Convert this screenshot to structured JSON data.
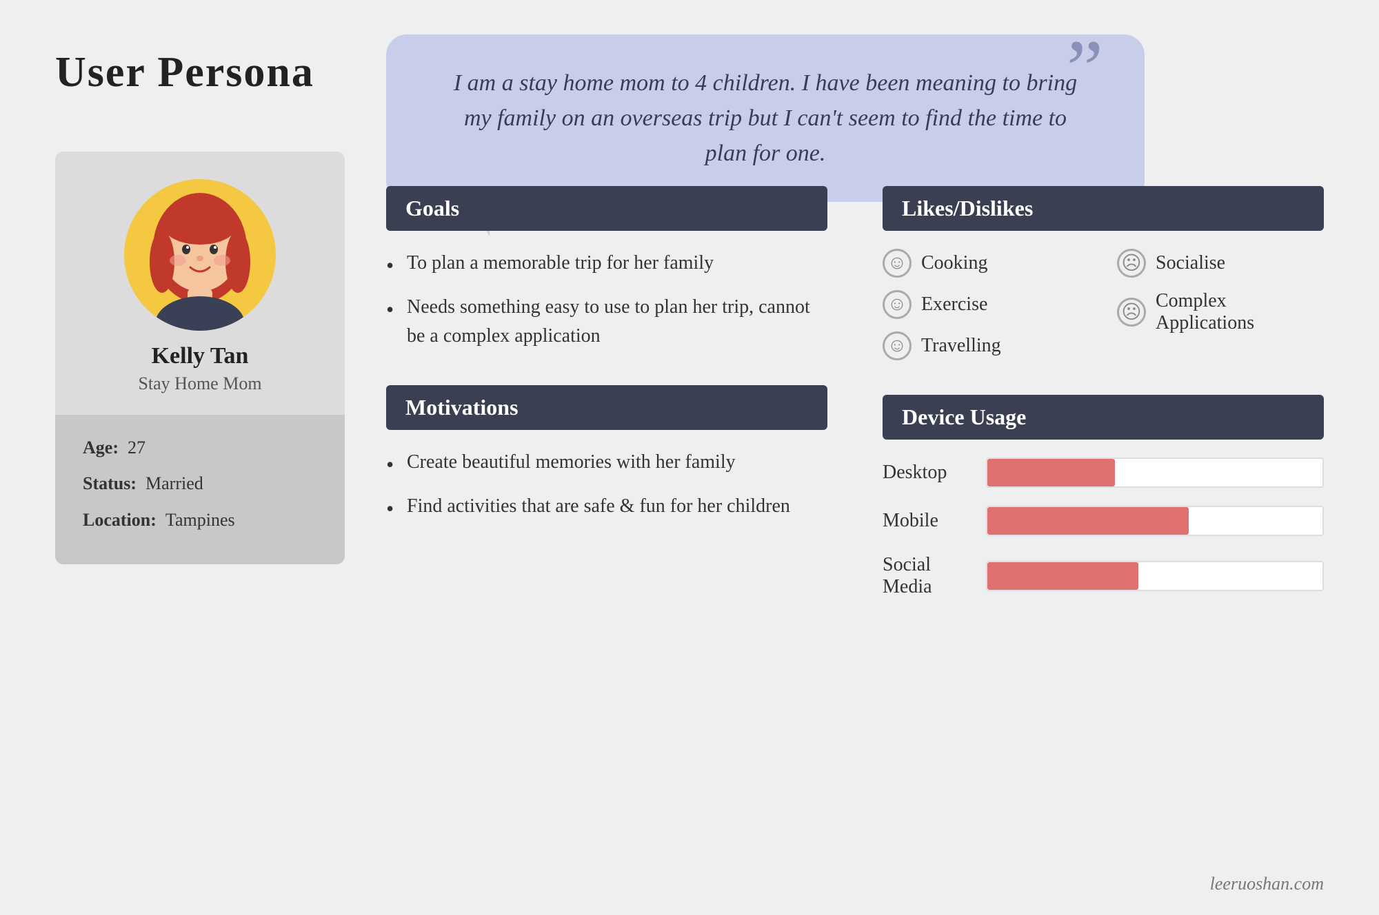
{
  "page": {
    "title": "User Persona",
    "background_color": "#efefef"
  },
  "quote": {
    "text": "I am a stay home mom to 4 children. I have been meaning to bring my family on an overseas trip but I can't seem to find the time to plan for one.",
    "quote_mark": "”"
  },
  "profile": {
    "name": "Kelly Tan",
    "role": "Stay Home Mom",
    "age_label": "Age:",
    "age_value": "27",
    "status_label": "Status:",
    "status_value": "Married",
    "location_label": "Location:",
    "location_value": "Tampines"
  },
  "goals": {
    "header": "Goals",
    "items": [
      "To plan a memorable trip for her family",
      "Needs something easy to use to plan her trip, cannot be a complex application"
    ]
  },
  "motivations": {
    "header": "Motivations",
    "items": [
      "Create beautiful memories with her family",
      "Find activities that are safe & fun for her children"
    ]
  },
  "likes_dislikes": {
    "header": "Likes/Dislikes",
    "likes": [
      {
        "label": "Cooking",
        "type": "happy"
      },
      {
        "label": "Exercise",
        "type": "happy"
      },
      {
        "label": "Travelling",
        "type": "happy"
      }
    ],
    "dislikes": [
      {
        "label": "Socialise",
        "type": "sad"
      },
      {
        "label": "Complex Applications",
        "type": "sad"
      }
    ]
  },
  "device_usage": {
    "header": "Device Usage",
    "devices": [
      {
        "label": "Desktop",
        "percent": 38
      },
      {
        "label": "Mobile",
        "percent": 60
      },
      {
        "label": "Social Media",
        "percent": 45
      }
    ]
  },
  "footer": {
    "credit": "leeruoshan.com"
  }
}
